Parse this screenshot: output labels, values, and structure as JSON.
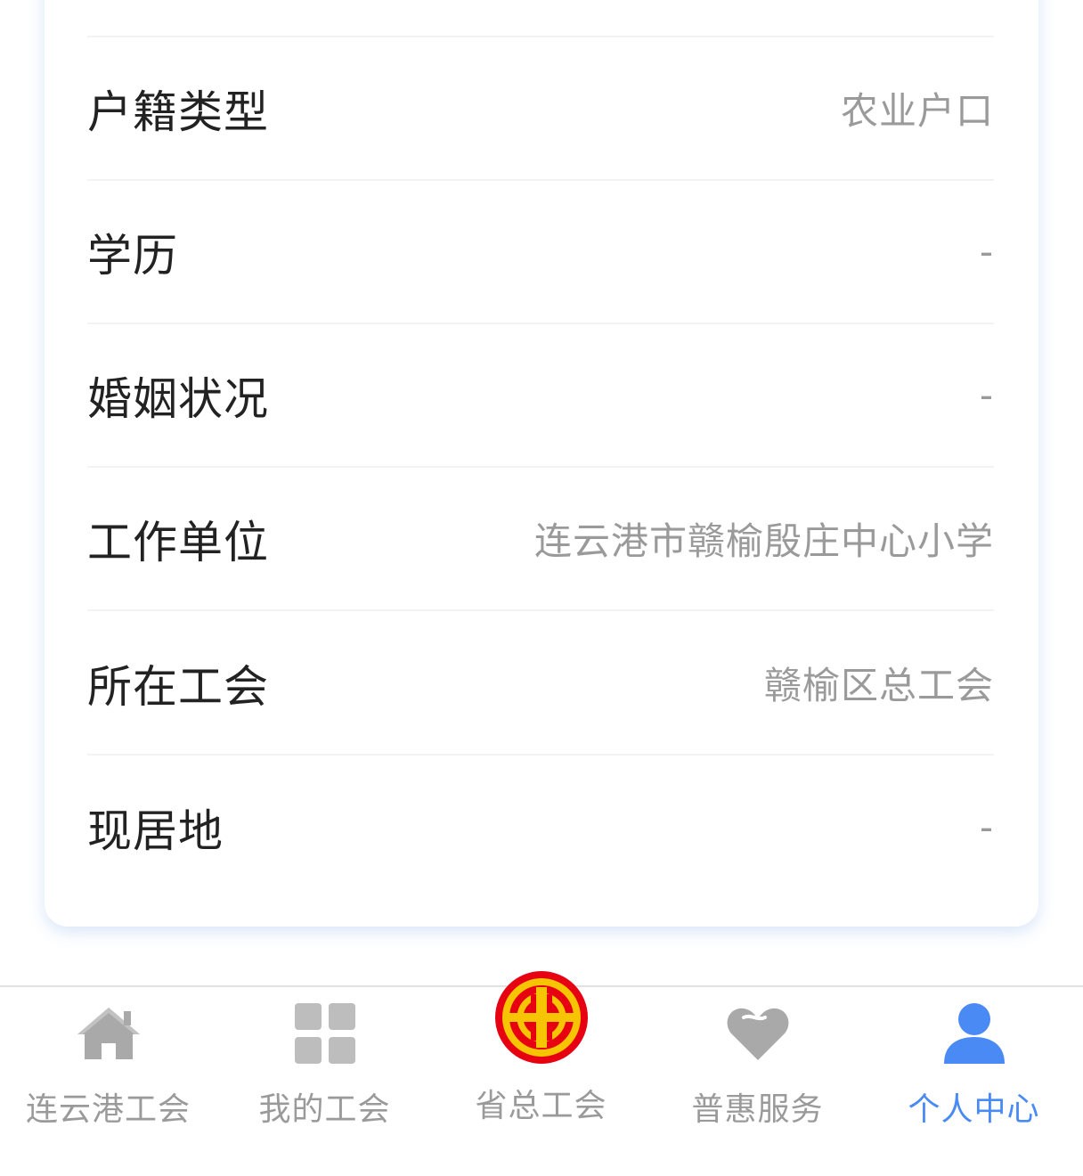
{
  "profile": {
    "rows": [
      {
        "label": "户籍类型",
        "value": "农业户口"
      },
      {
        "label": "学历",
        "value": "-"
      },
      {
        "label": "婚姻状况",
        "value": "-"
      },
      {
        "label": "工作单位",
        "value": "连云港市赣榆殷庄中心小学"
      },
      {
        "label": "所在工会",
        "value": "赣榆区总工会"
      },
      {
        "label": "现居地",
        "value": "-"
      }
    ]
  },
  "tabbar": {
    "tabs": [
      {
        "label": "连云港工会",
        "icon": "home-icon"
      },
      {
        "label": "我的工会",
        "icon": "grid-icon"
      },
      {
        "label": "省总工会",
        "icon": "union-logo-icon"
      },
      {
        "label": "普惠服务",
        "icon": "heart-icon"
      },
      {
        "label": "个人中心",
        "icon": "user-icon",
        "active": true
      }
    ]
  },
  "colors": {
    "active": "#4a8af4",
    "inactive": "#9a9a9a",
    "icon_gray": "#a9a9a9",
    "logo_red": "#e60012",
    "logo_yellow": "#f6c400"
  }
}
